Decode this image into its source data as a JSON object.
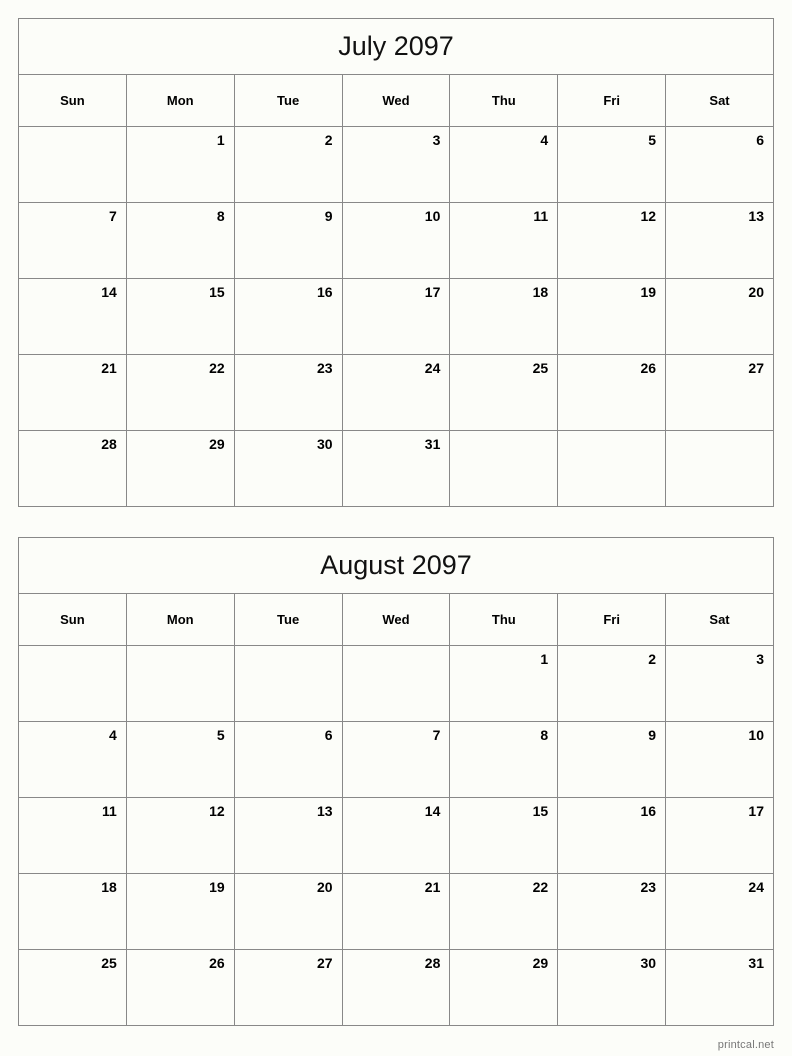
{
  "page": {
    "footer_text": "printcal.net",
    "background_color": "#fcfdf9",
    "border_color": "#888888",
    "text_color": "#000000",
    "footer_color": "#777777"
  },
  "calendars": [
    {
      "title": "July 2097",
      "weekday_headers": [
        "Sun",
        "Mon",
        "Tue",
        "Wed",
        "Thu",
        "Fri",
        "Sat"
      ],
      "weeks": [
        [
          "",
          "1",
          "2",
          "3",
          "4",
          "5",
          "6"
        ],
        [
          "7",
          "8",
          "9",
          "10",
          "11",
          "12",
          "13"
        ],
        [
          "14",
          "15",
          "16",
          "17",
          "18",
          "19",
          "20"
        ],
        [
          "21",
          "22",
          "23",
          "24",
          "25",
          "26",
          "27"
        ],
        [
          "28",
          "29",
          "30",
          "31",
          "",
          "",
          ""
        ]
      ]
    },
    {
      "title": "August 2097",
      "weekday_headers": [
        "Sun",
        "Mon",
        "Tue",
        "Wed",
        "Thu",
        "Fri",
        "Sat"
      ],
      "weeks": [
        [
          "",
          "",
          "",
          "",
          "1",
          "2",
          "3"
        ],
        [
          "4",
          "5",
          "6",
          "7",
          "8",
          "9",
          "10"
        ],
        [
          "11",
          "12",
          "13",
          "14",
          "15",
          "16",
          "17"
        ],
        [
          "18",
          "19",
          "20",
          "21",
          "22",
          "23",
          "24"
        ],
        [
          "25",
          "26",
          "27",
          "28",
          "29",
          "30",
          "31"
        ]
      ]
    }
  ]
}
